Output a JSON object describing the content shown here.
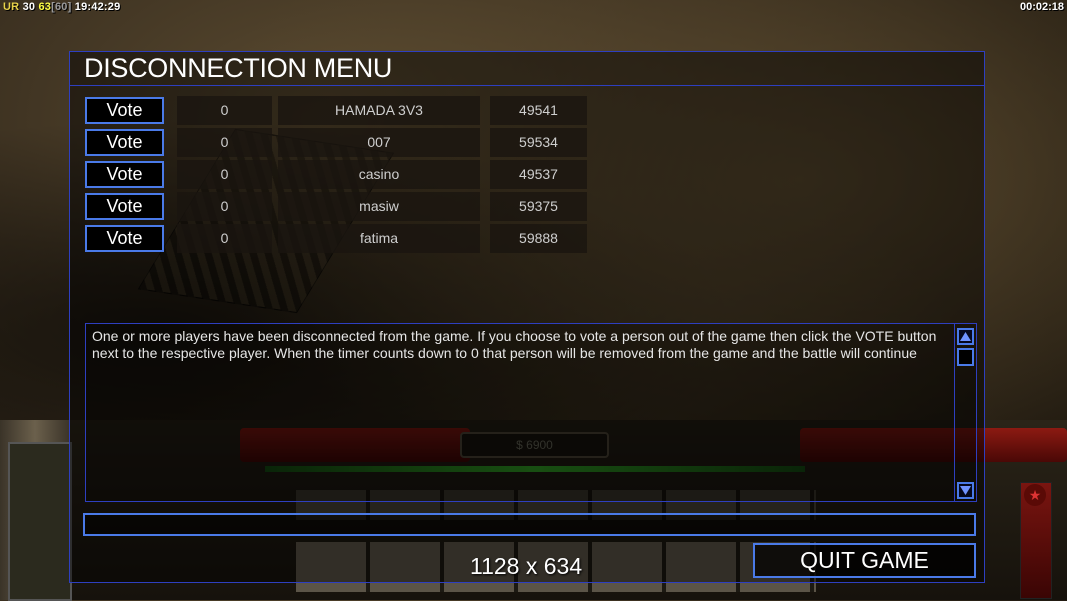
{
  "hud": {
    "api": "UR",
    "fps": "30",
    "frame": "63",
    "cap": "[60]",
    "clock": "19:42:29",
    "game_timer": "00:02:18"
  },
  "dialog": {
    "title": "DISCONNECTION MENU",
    "vote_label": "Vote",
    "players": [
      {
        "votes": "0",
        "name": "HAMADA 3V3",
        "ping": "49541"
      },
      {
        "votes": "0",
        "name": "007",
        "ping": "59534"
      },
      {
        "votes": "0",
        "name": "casino",
        "ping": "49537"
      },
      {
        "votes": "0",
        "name": "masiw",
        "ping": "59375"
      },
      {
        "votes": "0",
        "name": "fatima",
        "ping": "59888"
      }
    ],
    "message": "One or more players have been disconnected from the game. If you choose to vote a person out of the game then click the VOTE button next to the respective player. When the timer counts down to 0 that person will be removed from the game and the battle will continue",
    "quit_label": "QUIT GAME"
  },
  "command_bar": {
    "money": "$ 6900"
  },
  "overlay": {
    "resolution": "1128 x 634"
  },
  "icons": {
    "scroll_up": "triangle-up-icon",
    "scroll_down": "triangle-down-icon",
    "faction": "star-icon"
  },
  "colors": {
    "border_blue": "#4a7ae8",
    "frame_blue": "#2e3fc0"
  }
}
